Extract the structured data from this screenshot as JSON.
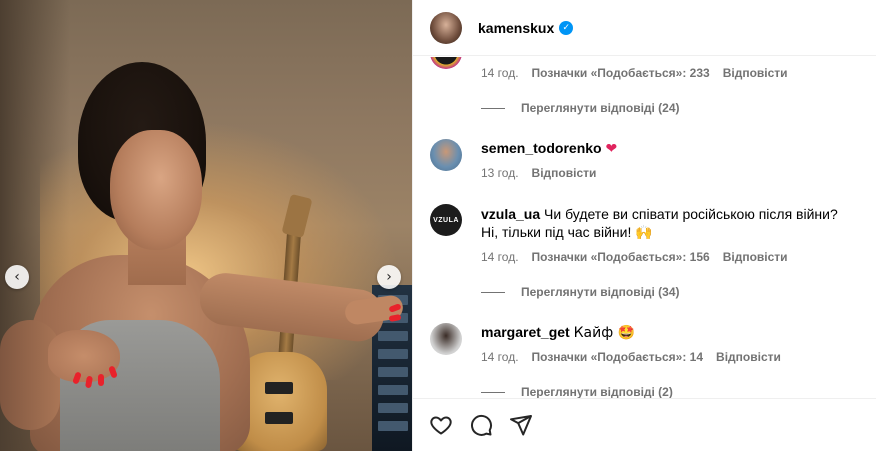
{
  "post": {
    "author": "kamenskux"
  },
  "comments": [
    {
      "username": "",
      "text": "",
      "time": "14 год.",
      "likes": "Позначки «Подобається»: 233",
      "reply": "Відповісти",
      "view_replies": "Переглянути відповіді (24)"
    },
    {
      "username": "semen_todorenko",
      "text": "",
      "emoji": "❤",
      "time": "13 год.",
      "reply": "Відповісти"
    },
    {
      "username": "vzula_ua",
      "avatar_text": "VZULA",
      "text": "Чи будете ви співати російською після війни? Ні, тільки під час війни! 🙌",
      "time": "14 год.",
      "likes": "Позначки «Подобається»: 156",
      "reply": "Відповісти",
      "view_replies": "Переглянути відповіді (34)"
    },
    {
      "username": "margaret_get",
      "text": "Кайф 🤩",
      "time": "14 год.",
      "likes": "Позначки «Подобається»: 14",
      "reply": "Відповісти",
      "view_replies": "Переглянути відповіді (2)"
    }
  ],
  "icons": {
    "carousel_prev": "chevron-left-icon",
    "carousel_next": "chevron-right-icon",
    "verified": "verified-badge-icon",
    "like": "heart-icon",
    "comment": "comment-icon",
    "share": "share-icon"
  },
  "colors": {
    "verified": "#0095f6",
    "secondary_text": "#737373",
    "divider": "#efefef",
    "like_heart": "#e0245e"
  }
}
